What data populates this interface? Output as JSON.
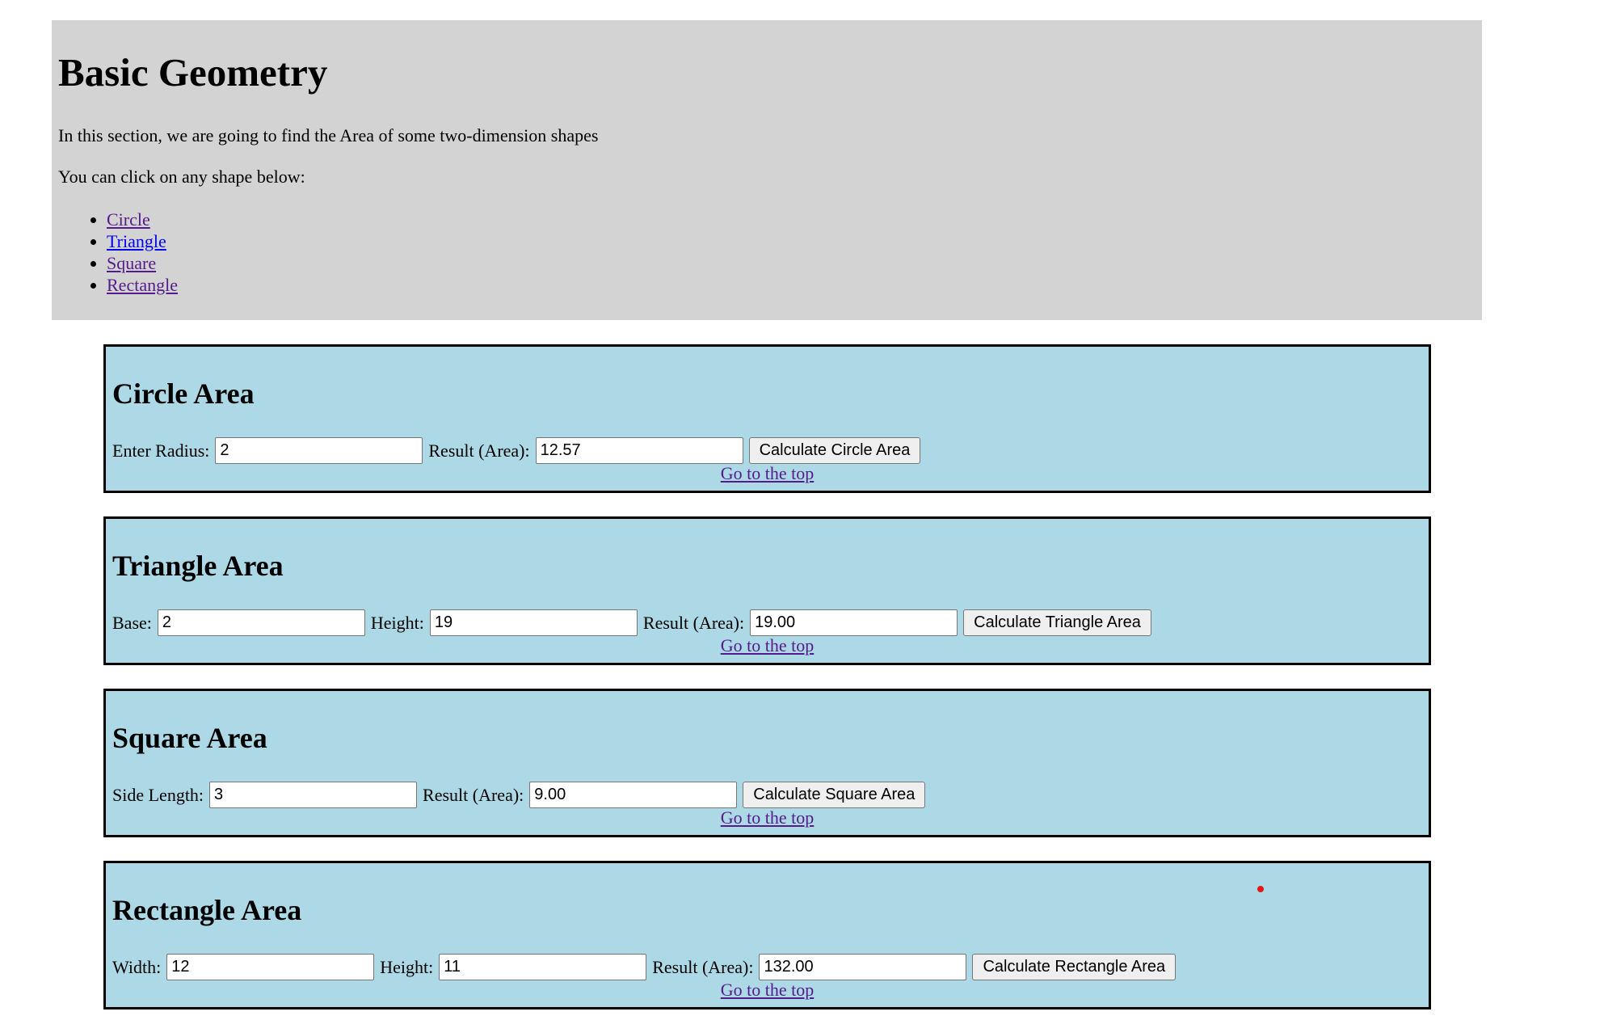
{
  "header": {
    "title": "Basic Geometry",
    "intro": "In this section, we are going to find the Area of some two-dimension shapes",
    "prompt": "You can click on any shape below:",
    "links": [
      "Circle",
      "Triangle",
      "Square",
      "Rectangle"
    ]
  },
  "circle": {
    "title": "Circle Area",
    "radius_label": "Enter Radius:",
    "radius_value": "2",
    "result_label": "Result (Area):",
    "result_value": "12.57",
    "button_label": "Calculate Circle Area",
    "top_link": "Go to the top"
  },
  "triangle": {
    "title": "Triangle Area",
    "base_label": "Base:",
    "base_value": "2",
    "height_label": "Height:",
    "height_value": "19",
    "result_label": "Result (Area):",
    "result_value": "19.00",
    "button_label": "Calculate Triangle Area",
    "top_link": "Go to the top"
  },
  "square": {
    "title": "Square Area",
    "side_label": "Side Length:",
    "side_value": "3",
    "result_label": "Result (Area):",
    "result_value": "9.00",
    "button_label": "Calculate Square Area",
    "top_link": "Go to the top"
  },
  "rectangle": {
    "title": "Rectangle Area",
    "width_label": "Width:",
    "width_value": "12",
    "height_label": "Height:",
    "height_value": "11",
    "result_label": "Result (Area):",
    "result_value": "132.00",
    "button_label": "Calculate Rectangle Area",
    "top_link": "Go to the top"
  }
}
